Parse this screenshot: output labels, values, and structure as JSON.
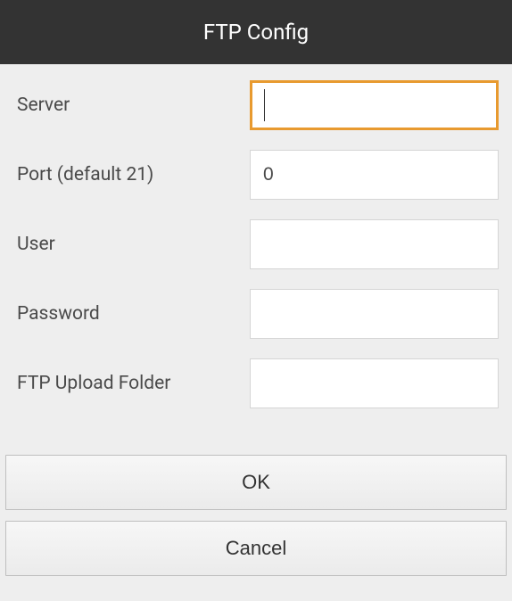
{
  "header": {
    "title": "FTP Config"
  },
  "fields": {
    "server": {
      "label": "Server",
      "value": ""
    },
    "port": {
      "label": "Port (default 21)",
      "value": "0"
    },
    "user": {
      "label": "User",
      "value": ""
    },
    "password": {
      "label": "Password",
      "value": ""
    },
    "upload_folder": {
      "label": "FTP Upload Folder",
      "value": ""
    }
  },
  "buttons": {
    "ok": "OK",
    "cancel": "Cancel"
  }
}
